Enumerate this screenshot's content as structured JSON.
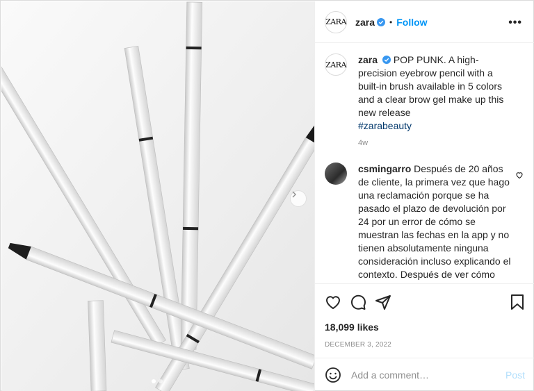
{
  "post": {
    "author": "zara",
    "avatar_text": "ZARA",
    "follow_label": "Follow",
    "separator": "•",
    "more_label": "•••",
    "caption_text": "POP PUNK. A high-precision eyebrow pencil with a built-in brush available in 5 colors and a clear brow gel make up this new release",
    "hashtag": "#zarabeauty",
    "age": "4w",
    "likes": "18,099 likes",
    "date": "DECEMBER 3, 2022"
  },
  "comment": {
    "author": "csmingarro",
    "text": "Después de 20 años de cliente, la primera vez que hago una reclamación porque se ha pasado el plazo de devolución por 24 por un error de cómo se muestran las fechas en la app y no tienen absolutamente ninguna consideración incluso explicando el contexto. Después de ver cómo tratan a los clientes no volveré a considerar Zara como una empresa en la que confiar. Espero que"
  },
  "composer": {
    "placeholder": "Add a comment…",
    "post_label": "Post"
  },
  "carousel": {
    "slide_count": 2,
    "active_slide": 1
  },
  "icons": {
    "verified": "verified-badge-icon",
    "like": "heart-icon",
    "comment": "comment-bubble-icon",
    "share": "paper-plane-icon",
    "save": "bookmark-icon",
    "emoji": "smiley-icon",
    "next": "chevron-right-icon"
  },
  "colors": {
    "accent": "#0095f6",
    "verified": "#3897f0",
    "hashtag": "#00376b",
    "muted": "#8e8e8e",
    "post_disabled": "#b2dffc"
  }
}
